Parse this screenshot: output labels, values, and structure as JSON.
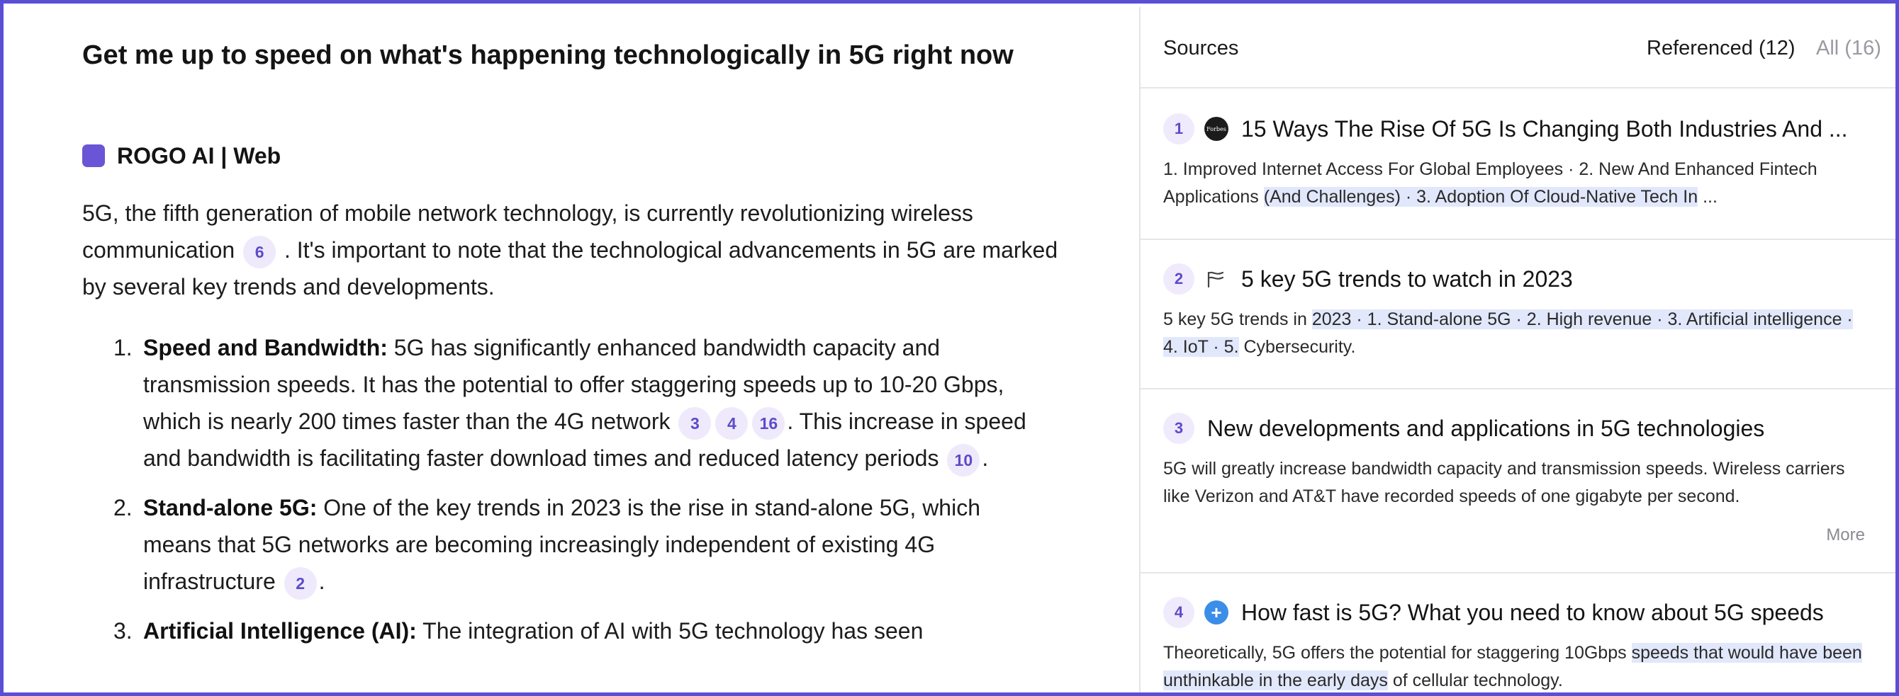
{
  "answer": {
    "title": "Get me up to speed on what's happening technologically in 5G right now",
    "model_label": "ROGO AI | Web",
    "intro": {
      "part1": "5G, the fifth generation of mobile network technology, is currently revolutionizing wireless communication",
      "cite1": "6",
      "part2": ". It's important to note that the technological advancements in 5G are marked by several key trends and developments."
    },
    "items": [
      {
        "num": "1.",
        "bold": "Speed and Bandwidth:",
        "text1": " 5G has significantly enhanced bandwidth capacity and transmission speeds. It has the potential to offer staggering speeds up to 10-20 Gbps, which is nearly 200 times faster than the 4G network",
        "cites1": [
          "3",
          "4",
          "16"
        ],
        "text2": ". This increase in speed and bandwidth is facilitating faster download times and reduced latency periods",
        "cites2": [
          "10"
        ],
        "text3": "."
      },
      {
        "num": "2.",
        "bold": "Stand-alone 5G:",
        "text1": " One of the key trends in 2023 is the rise in stand-alone 5G, which means that 5G networks are becoming increasingly independent of existing 4G infrastructure",
        "cites1": [
          "2"
        ],
        "text2": "."
      },
      {
        "num": "3.",
        "bold": "Artificial Intelligence (AI):",
        "text1": " The integration of AI with 5G technology has seen"
      }
    ]
  },
  "sources": {
    "title": "Sources",
    "tab_referenced": "Referenced (12)",
    "tab_all": "All (16)",
    "more_label": "More",
    "cards": [
      {
        "num": "1",
        "icon": "forbes-favicon",
        "favicon_text": "Forbes",
        "title": "15 Ways The Rise Of 5G Is Changing Both Industries And ...",
        "snippet_a": "1. Improved Internet Access For Global Employees · 2. New And Enhanced Fintech Applications ",
        "snippet_hl": "(And Challenges) · 3. Adoption Of Cloud-Native Tech In",
        "snippet_b": " ..."
      },
      {
        "num": "2",
        "icon": "flag-favicon",
        "title": "5 key 5G trends to watch in 2023",
        "snippet_a": "5 key 5G trends in ",
        "snippet_hl": "2023 · 1. Stand-alone 5G · 2. High revenue · 3. Artificial intelligence · 4. IoT · 5.",
        "snippet_b": " Cybersecurity."
      },
      {
        "num": "3",
        "icon": "none",
        "title": "New developments and applications in 5G technologies",
        "snippet_a": "5G will greatly increase bandwidth capacity and transmission speeds. Wireless carriers like Verizon and AT&T have recorded speeds of one gigabyte per second.",
        "snippet_hl": "",
        "snippet_b": ""
      },
      {
        "num": "4",
        "icon": "plus-favicon",
        "title": "How fast is 5G? What you need to know about 5G speeds",
        "snippet_a": "Theoretically, 5G offers the potential for staggering 10Gbps ",
        "snippet_hl": "speeds that would have been unthinkable in the early days",
        "snippet_b": " of cellular technology."
      }
    ]
  },
  "colors": {
    "frame": "#5b4fd6",
    "citation_bg": "#eeeafb",
    "citation_text": "#5d4bc9",
    "highlight": "#e2e8fb"
  }
}
